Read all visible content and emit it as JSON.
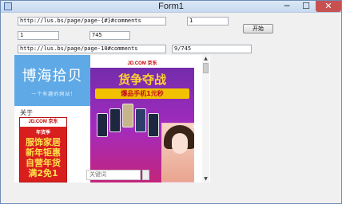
{
  "window": {
    "title": "Form1",
    "controls": {
      "minimize": "─",
      "maximize": "☐",
      "close": "✕"
    }
  },
  "form": {
    "url_template_1": "http://lus.bs/page/page-{#}#comments",
    "page_start": "1",
    "start_button": "开始",
    "field_1": "1",
    "field_745": "745",
    "url_template_2": "http://lus.bs/page/page-10#comments",
    "progress": "9/745"
  },
  "browser": {
    "brand_title": "博海拾贝",
    "brand_subtitle": "一个有趣的网站!",
    "about_label": "关于",
    "side_ad": {
      "logo": "JD.COM 京东",
      "tag": "年货季",
      "lines": [
        "服饰家居",
        "新年钜惠",
        "自营年货",
        "满2免1"
      ]
    },
    "main_ad": {
      "logo": "JD.COM 京东",
      "headline": "货争夺战",
      "strip": "爆品手机1元秒",
      "close": "✕"
    },
    "search_placeholder": "关键词"
  },
  "scrollbar": {
    "up": "▲",
    "down": "▼"
  }
}
